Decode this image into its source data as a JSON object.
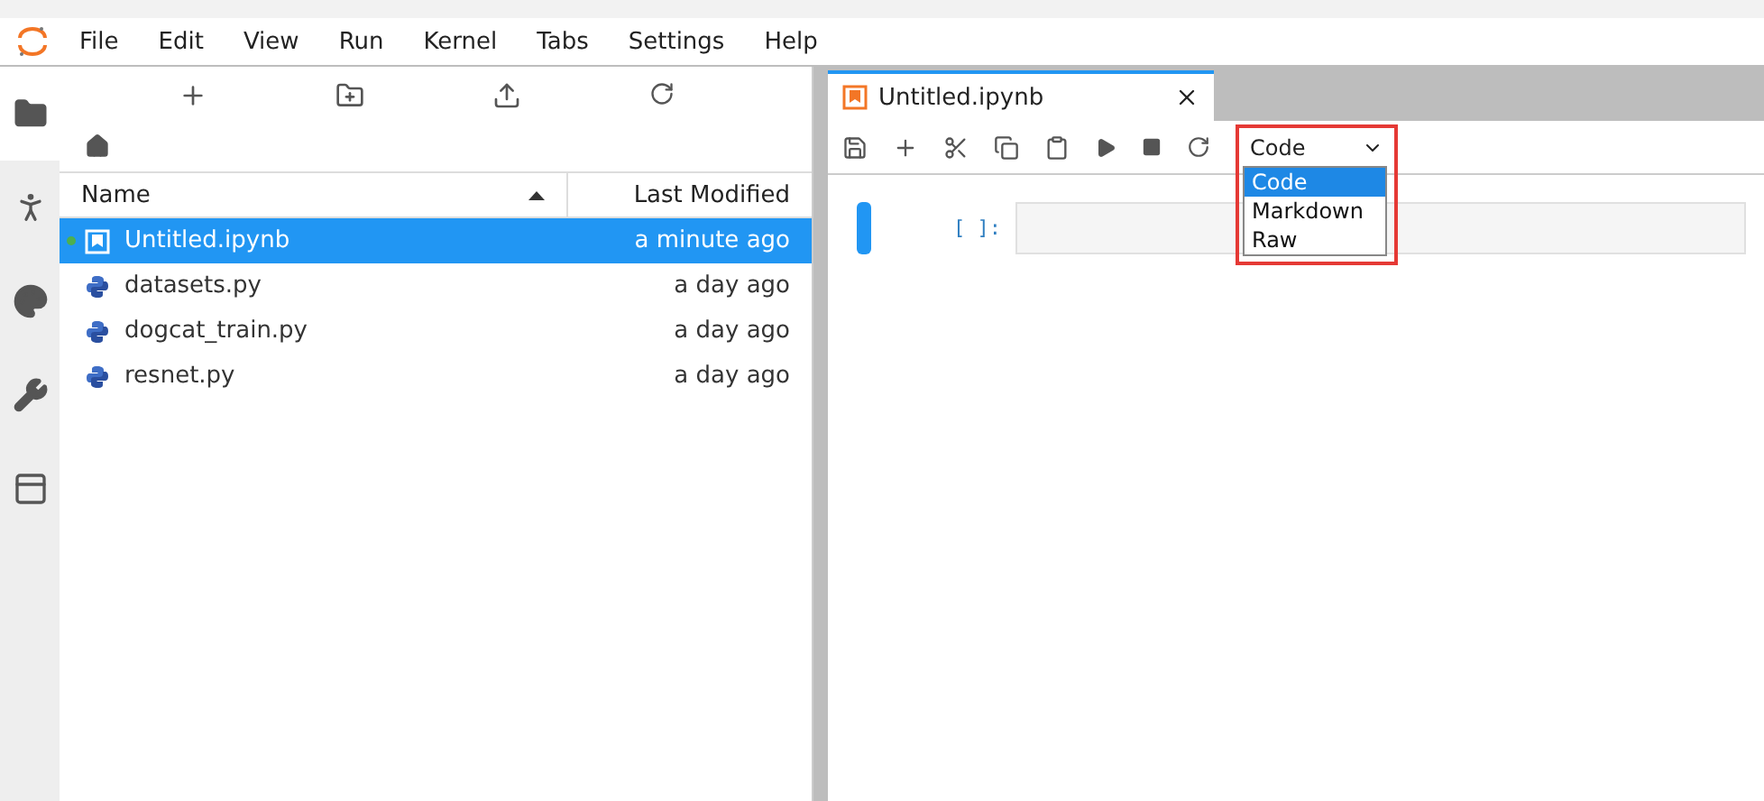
{
  "menu": [
    "File",
    "Edit",
    "View",
    "Run",
    "Kernel",
    "Tabs",
    "Settings",
    "Help"
  ],
  "sidebar": {
    "tabs": [
      {
        "kind": "files",
        "selected": true
      },
      {
        "kind": "running",
        "selected": false
      },
      {
        "kind": "commands",
        "selected": false
      },
      {
        "kind": "settings",
        "selected": false
      },
      {
        "kind": "tabs",
        "selected": false
      }
    ]
  },
  "file_browser": {
    "columns": [
      {
        "label": "Name",
        "sorted": true
      },
      {
        "label": "Last Modified",
        "sorted": false
      }
    ],
    "rows": [
      {
        "kind": "notebook",
        "name": "Untitled.ipynb",
        "modified": "a minute ago",
        "selected": true,
        "running": true
      },
      {
        "kind": "python",
        "name": "datasets.py",
        "modified": "a day ago",
        "selected": false,
        "running": false
      },
      {
        "kind": "python",
        "name": "dogcat_train.py",
        "modified": "a day ago",
        "selected": false,
        "running": false
      },
      {
        "kind": "python",
        "name": "resnet.py",
        "modified": "a day ago",
        "selected": false,
        "running": false
      }
    ]
  },
  "notebook": {
    "tab": {
      "title": "Untitled.ipynb",
      "selected": true
    },
    "cell_type": {
      "value": "Code",
      "expanded": true,
      "highlighted": true,
      "options": [
        {
          "label": "Code",
          "selected": true
        },
        {
          "label": "Markdown",
          "selected": false
        },
        {
          "label": "Raw",
          "selected": false
        }
      ]
    },
    "cells": [
      {
        "prompt": "[ ]:",
        "active": true
      }
    ]
  }
}
